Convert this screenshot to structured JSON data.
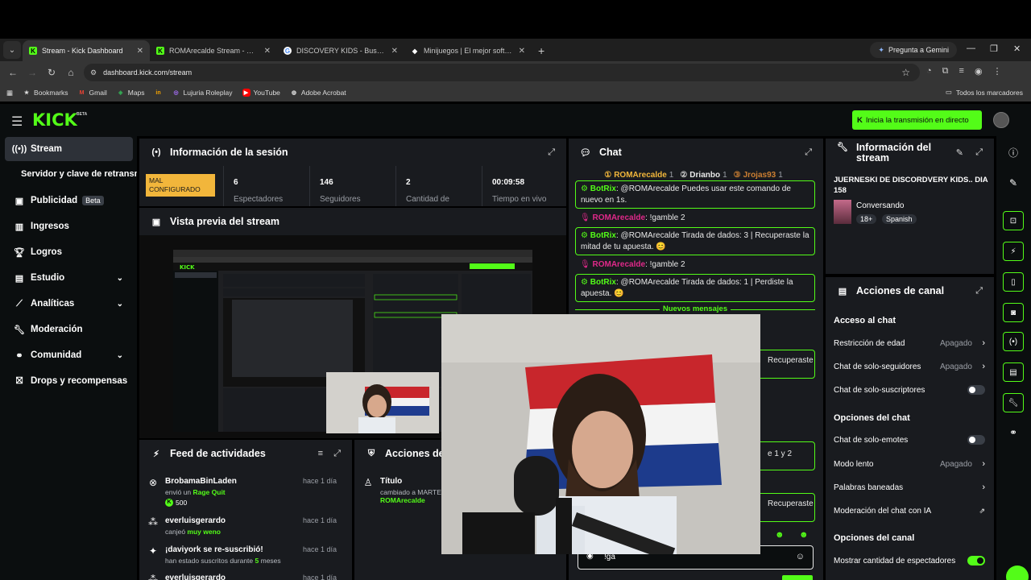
{
  "browser": {
    "tabs": [
      {
        "label": "Stream - Kick Dashboard",
        "icon": "kick-icon",
        "active": true
      },
      {
        "label": "ROMArecalde Stream - Watch L",
        "icon": "kick-icon",
        "active": false
      },
      {
        "label": "DISCOVERY KIDS - Buscar con G",
        "icon": "google-icon",
        "active": false
      },
      {
        "label": "Minijuegos | El mejor software",
        "icon": "diamond-icon",
        "active": false
      }
    ],
    "gemini_label": "Pregunta a Gemini",
    "url": "dashboard.kick.com/stream",
    "bookmarks": [
      {
        "label": "Bookmarks",
        "icon": "star-icon"
      },
      {
        "label": "Gmail",
        "icon": "gmail-icon"
      },
      {
        "label": "Maps",
        "icon": "maps-icon"
      },
      {
        "label": "",
        "icon": "in-icon"
      },
      {
        "label": "Lujuria Roleplay",
        "icon": "twitch-icon"
      },
      {
        "label": "YouTube",
        "icon": "youtube-icon"
      },
      {
        "label": "Adobe Acrobat",
        "icon": "acrobat-icon"
      }
    ],
    "all_bookmarks": "Todos los marcadores"
  },
  "header": {
    "logo": "KICK",
    "beta": "BETA",
    "go_live": "Inicia la transmisión en directo"
  },
  "sidebar": {
    "items": [
      {
        "label": "Stream",
        "active": true
      },
      {
        "label": "Servidor y clave de retransmisión"
      },
      {
        "label": "Publicidad",
        "badge": "Beta"
      },
      {
        "label": "Ingresos"
      },
      {
        "label": "Logros"
      },
      {
        "label": "Estudio"
      },
      {
        "label": "Analíticas"
      },
      {
        "label": "Moderación"
      },
      {
        "label": "Comunidad"
      },
      {
        "label": "Drops y recompensas"
      }
    ]
  },
  "session": {
    "title": "Información de la sesión",
    "status": "MAL CONFIGURADO",
    "stats": [
      {
        "value": "6",
        "label": "Espectadores"
      },
      {
        "value": "146",
        "label": "Seguidores"
      },
      {
        "value": "2",
        "label": "Cantidad de"
      },
      {
        "value": "00:09:58",
        "label": "Tiempo en vivo"
      }
    ]
  },
  "preview": {
    "title": "Vista previa del stream"
  },
  "feed": {
    "title": "Feed de actividades",
    "items": [
      {
        "name": "BrobamaBinLaden",
        "time": "hace 1 día",
        "desc_pre": "envió un ",
        "desc_hl": "Rage Quit",
        "desc_post": "",
        "extra": "500"
      },
      {
        "name": "everluisgerardo",
        "time": "hace 1 día",
        "desc_pre": "canjeó ",
        "desc_hl": "muy weno",
        "desc_post": ""
      },
      {
        "name": "¡daviyork se re-suscribió!",
        "time": "hace 1 día",
        "desc_pre": "han estado suscritos durante ",
        "desc_hl": "5",
        "desc_post": " meses"
      },
      {
        "name": "everluisgerardo",
        "time": "hace 1 día",
        "desc_pre": "",
        "desc_hl": "",
        "desc_post": ""
      }
    ]
  },
  "mod_actions": {
    "title": "Acciones de",
    "item_title": "Título",
    "item_desc": "cambiado a MARTES",
    "item_user": "ROMArecalde"
  },
  "chat": {
    "title": "Chat",
    "top_users": [
      {
        "name": "ROMArecalde",
        "count": "1"
      },
      {
        "name": "Drianbo",
        "count": "1"
      },
      {
        "name": "Jrojas93",
        "count": "1"
      }
    ],
    "messages": [
      {
        "user": "BotRix",
        "bot": true,
        "text": "@ROMArecalde Puedes usar este comando de nuevo en 1s."
      },
      {
        "user": "ROMArecalde",
        "bot": false,
        "text": "!gamble 2"
      },
      {
        "user": "BotRix",
        "bot": true,
        "text": "@ROMArecalde Tirada de dados: 3 | Recuperaste la mitad de tu apuesta. 😊"
      },
      {
        "user": "ROMArecalde",
        "bot": false,
        "text": "!gamble 2"
      },
      {
        "user": "BotRix",
        "bot": true,
        "text": "@ROMArecalde Tirada de dados: 1 | Perdiste la apuesta. 😊"
      }
    ],
    "new_messages": "Nuevos mensajes",
    "hidden_fragments": [
      "Recuperaste",
      "e 1 y 2",
      "Recuperaste"
    ],
    "input_value": "!ga"
  },
  "stream_info": {
    "title": "Información del stream",
    "stream_title": "JUERNESKI DE DISCORDVERY KIDS.. DIA 158",
    "category": "Conversando",
    "tags": [
      "18+",
      "Spanish"
    ]
  },
  "channel_actions": {
    "title": "Acciones de canal",
    "chat_access": "Acceso al chat",
    "rows1": [
      {
        "label": "Restricción de edad",
        "value": "Apagado",
        "type": "arrow"
      },
      {
        "label": "Chat de solo-seguidores",
        "value": "Apagado",
        "type": "arrow"
      },
      {
        "label": "Chat de solo-suscriptores",
        "value": "",
        "type": "toggle"
      }
    ],
    "chat_options": "Opciones del chat",
    "rows2": [
      {
        "label": "Chat de solo-emotes",
        "value": "",
        "type": "toggle"
      },
      {
        "label": "Modo lento",
        "value": "Apagado",
        "type": "arrow"
      },
      {
        "label": "Palabras baneadas",
        "value": "",
        "type": "arrow"
      },
      {
        "label": "Moderación del chat con IA",
        "value": "",
        "type": "link"
      }
    ],
    "channel_options": "Opciones del canal",
    "rows3": [
      {
        "label": "Mostrar cantidad de espectadores",
        "value": "",
        "type": "toggle-on"
      }
    ]
  },
  "colors": {
    "kick_green": "#53fc18",
    "panel_bg": "#191b1f",
    "warning": "#f2b63b",
    "username_pink": "#e0298a"
  }
}
